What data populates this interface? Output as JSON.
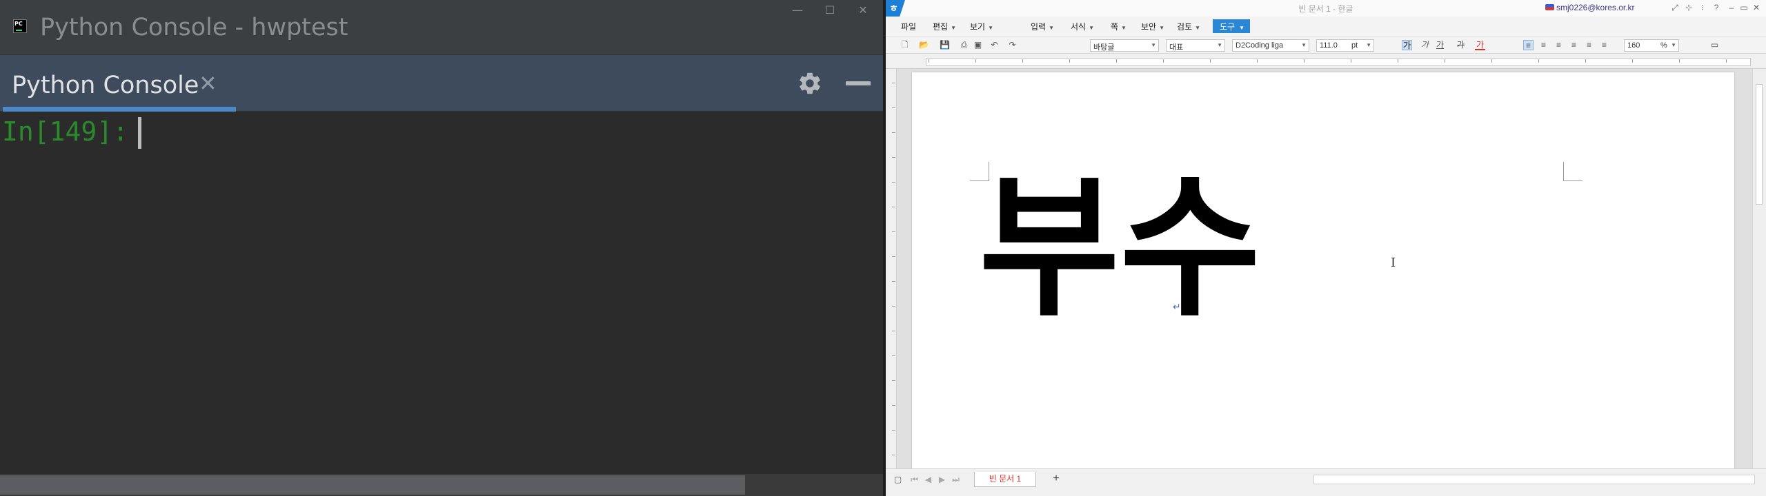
{
  "python_console": {
    "window_title": "Python Console - hwptest",
    "tab_label": "Python Console",
    "prompt": "In[149]: "
  },
  "hwp": {
    "window_title": "빈 문서 1 - 한글",
    "user_email": "smj0226@kores.or.kr",
    "menus": [
      "파일",
      "편집",
      "보기",
      "입력",
      "서식",
      "쪽",
      "보안",
      "검토",
      "도구"
    ],
    "toolbar": {
      "style": "바탕글",
      "font_group": "대표",
      "font": "D2Coding liga",
      "font_size": "111.0",
      "font_size_unit": "pt",
      "zoom": "160",
      "zoom_unit": "%",
      "bold_label": "가",
      "italic_label": "가",
      "underline_label": "가",
      "strike_label": "가",
      "color_label": "가"
    },
    "document_text": "부수",
    "doc_tab": "빈 문서 1",
    "colors": {
      "accent": "#2b86d4",
      "doc_tab_text": "#d0332b"
    }
  }
}
